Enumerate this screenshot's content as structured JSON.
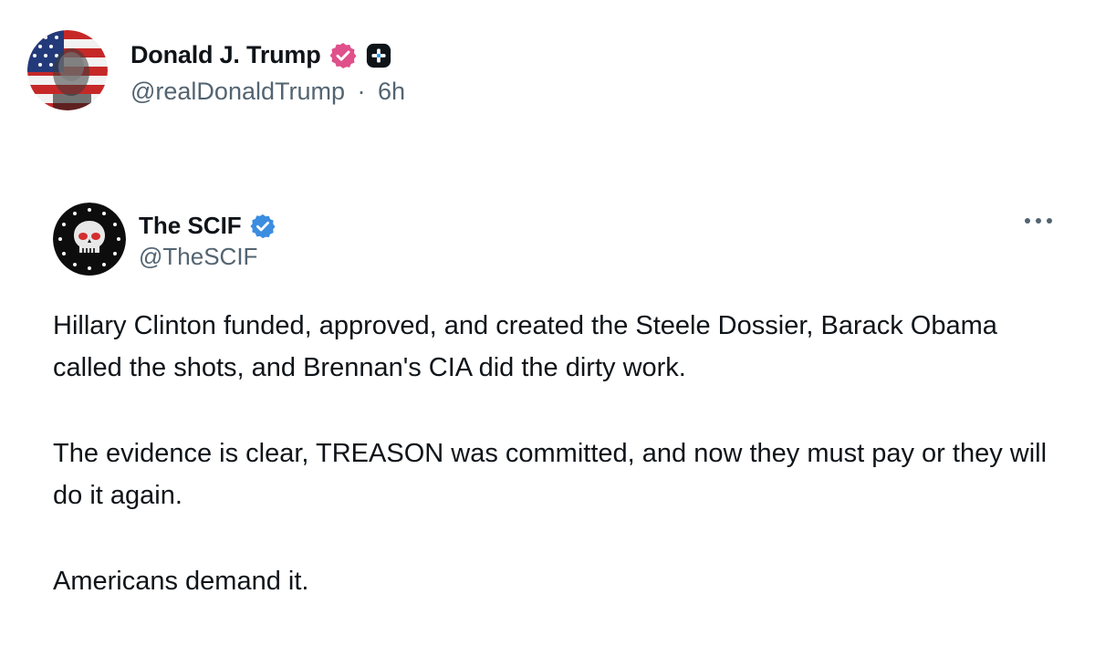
{
  "post": {
    "author": {
      "display_name": "Donald J. Trump",
      "handle": "@realDonaldTrump",
      "separator": "·",
      "timestamp": "6h",
      "verified_badge_color": "#e0508a",
      "avatar_icon": "flag-portrait-avatar",
      "extra_badge_icon": "plus-square-icon"
    }
  },
  "quote": {
    "author": {
      "display_name": "The SCIF",
      "handle": "@TheSCIF",
      "verified_badge_color": "#3b8de0",
      "avatar_icon": "skull-avatar"
    },
    "more_icon": "more-options-icon",
    "paragraphs": [
      "Hillary Clinton funded, approved, and created the Steele Dossier, Barack Obama called the shots, and Brennan's CIA did the dirty work.",
      "The evidence is clear, TREASON was committed, and now they must pay or they will do it again.",
      "Americans demand it."
    ]
  }
}
